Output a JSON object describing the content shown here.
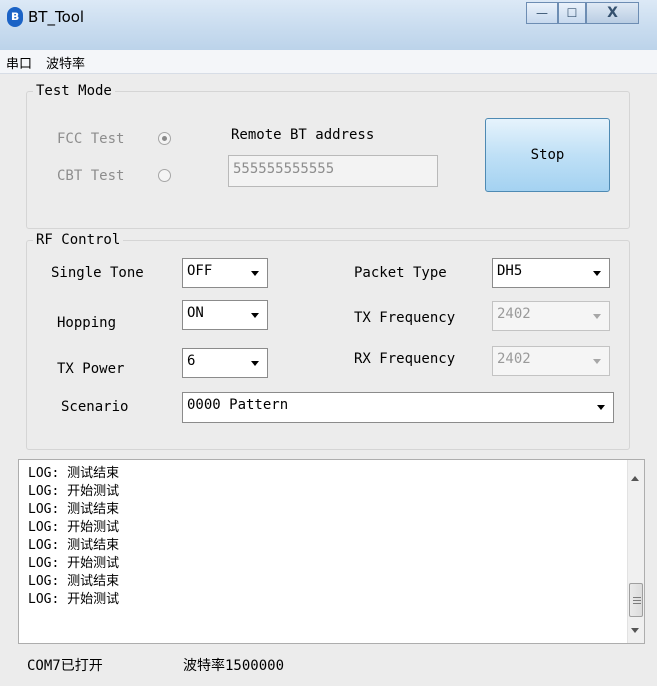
{
  "window": {
    "title": "BT_Tool",
    "minimize": "—",
    "maximize": "☐",
    "close": "X"
  },
  "menu": [
    "串口",
    "波特率"
  ],
  "test_mode": {
    "legend": "Test Mode",
    "fcc_label": "FCC Test",
    "cbt_label": "CBT Test",
    "selected": "FCC Test",
    "remote_label": "Remote BT address",
    "remote_value": "555555555555",
    "stop_label": "Stop"
  },
  "rf_control": {
    "legend": "RF Control",
    "single_tone": {
      "label": "Single Tone",
      "value": "OFF"
    },
    "hopping": {
      "label": "Hopping",
      "value": "ON"
    },
    "tx_power": {
      "label": "TX Power",
      "value": "6"
    },
    "scenario": {
      "label": "Scenario",
      "value": "0000 Pattern"
    },
    "packet_type": {
      "label": "Packet Type",
      "value": "DH5"
    },
    "tx_frequency": {
      "label": "TX Frequency",
      "value": "2402"
    },
    "rx_frequency": {
      "label": "RX Frequency",
      "value": "2402"
    }
  },
  "log_lines": [
    "LOG: 测试结束",
    "LOG: 开始测试",
    "LOG: 测试结束",
    "LOG: 开始测试",
    "LOG: 测试结束",
    "LOG: 开始测试",
    "LOG: 测试结束",
    "LOG: 开始测试"
  ],
  "status": {
    "port": "COM7已打开",
    "baud": "波特率1500000"
  },
  "colors": {
    "title_bar": "#c9dcef",
    "stop_button": "#bfe0f6",
    "bt_icon": "#1b63c6"
  }
}
